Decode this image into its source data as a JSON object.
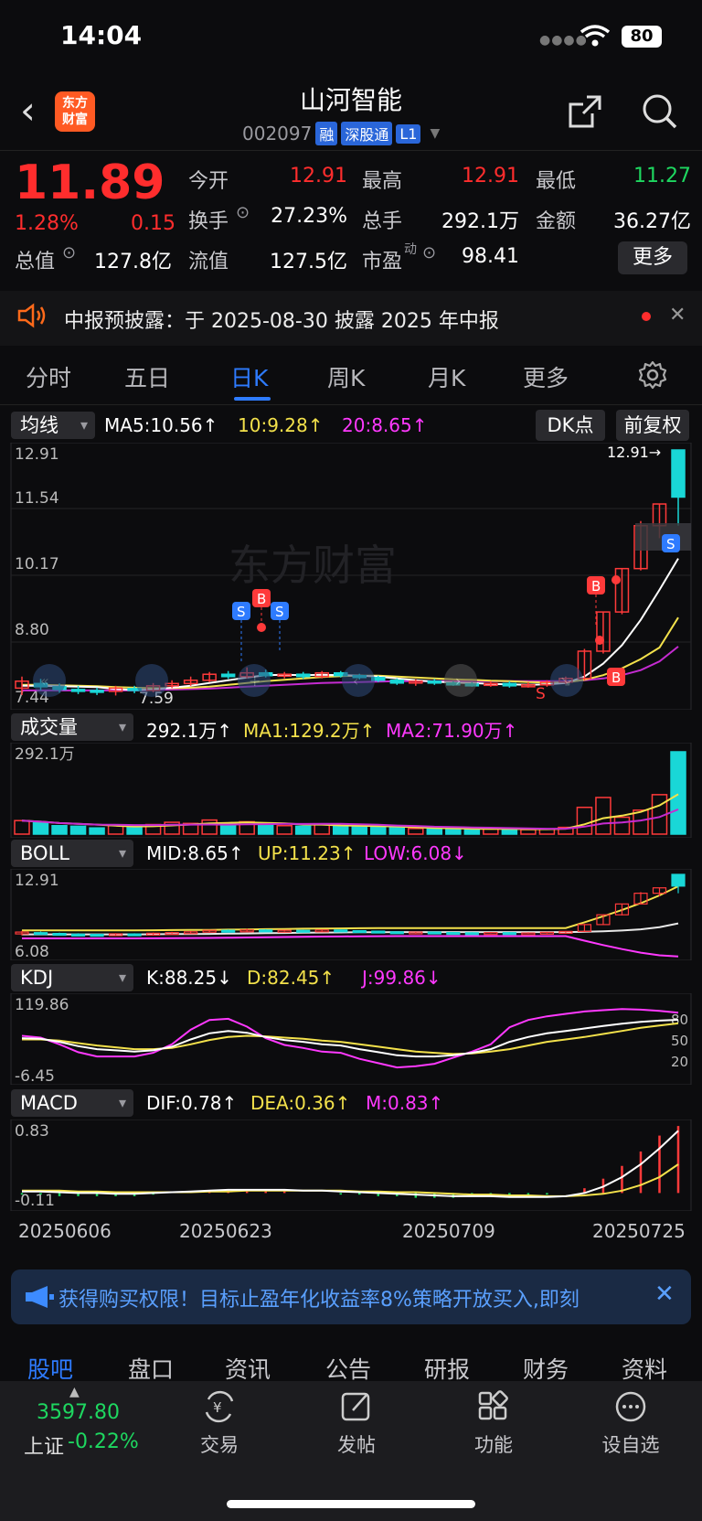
{
  "status_bar": {
    "time": "14:04",
    "battery": "80"
  },
  "header": {
    "logo_text": "东方\n财富",
    "stock_name": "山河智能",
    "code": "002097",
    "tags": [
      "融",
      "深股通",
      "L1"
    ]
  },
  "quote": {
    "price": "11.89",
    "change_pct": "1.28%",
    "change": "0.15",
    "fields": [
      {
        "label": "今开",
        "value": "12.91",
        "color": "red"
      },
      {
        "label": "最高",
        "value": "12.91",
        "color": "red"
      },
      {
        "label": "最低",
        "value": "11.27",
        "color": "green"
      },
      {
        "label": "换手",
        "value": "27.23%",
        "color": "white"
      },
      {
        "label": "总手",
        "value": "292.1万",
        "color": "white"
      },
      {
        "label": "金额",
        "value": "36.27亿",
        "color": "white"
      },
      {
        "label": "总值",
        "value": "127.8亿",
        "color": "white"
      },
      {
        "label": "流值",
        "value": "127.5亿",
        "color": "white"
      },
      {
        "label": "市盈",
        "value": "98.41",
        "color": "white"
      }
    ],
    "pe_superscript": "动",
    "more_label": "更多"
  },
  "notice": {
    "text": "中报预披露：于 2025-08-30 披露 2025 年中报"
  },
  "tabs": [
    "分时",
    "五日",
    "日K",
    "周K",
    "月K",
    "更多"
  ],
  "active_tab": "日K",
  "kline": {
    "indicator": "均线",
    "ma5": "MA5:10.56↑",
    "ma10": "10:9.28↑",
    "ma20": "20:8.65↑",
    "dk_label": "DK点",
    "adjust_label": "前复权",
    "axis": [
      "12.91",
      "11.54",
      "10.17",
      "8.80",
      "7.44"
    ],
    "low_mark": "7.59",
    "high_mark": "12.91→",
    "watermark": "东方财富"
  },
  "volume": {
    "indicator": "成交量",
    "value": "292.1万↑",
    "ma1": "MA1:129.2万↑",
    "ma2": "MA2:71.90万↑",
    "axis_top": "292.1万"
  },
  "boll": {
    "indicator": "BOLL",
    "mid": "MID:8.65↑",
    "up": "UP:11.23↑",
    "low": "LOW:6.08↓",
    "axis": [
      "12.91",
      "6.08"
    ]
  },
  "kdj": {
    "indicator": "KDJ",
    "k": "K:88.25↓",
    "d": "D:82.45↑",
    "j": "J:99.86↓",
    "axis": [
      "119.86",
      "-6.45"
    ],
    "levels": [
      "80",
      "50",
      "20"
    ]
  },
  "macd": {
    "indicator": "MACD",
    "dif": "DIF:0.78↑",
    "dea": "DEA:0.36↑",
    "m": "M:0.83↑",
    "axis": [
      "0.83",
      "-0.11"
    ]
  },
  "dates": [
    "20250606",
    "20250623",
    "20250709",
    "20250725"
  ],
  "ad": {
    "text": "获得购买权限！目标止盈年化收益率8%策略开放买入,即刻"
  },
  "bottom_tabs": [
    "股吧",
    "盘口",
    "资讯",
    "公告",
    "研报",
    "财务",
    "资料"
  ],
  "bottom_nav": {
    "index_value": "3597.80",
    "index_name": "上证",
    "index_change": "-0.22%",
    "items": [
      "交易",
      "发帖",
      "功能",
      "设自选"
    ]
  },
  "chart_data": {
    "type": "candlestick",
    "candles": [
      {
        "o": 7.75,
        "c": 7.9,
        "h": 8.0,
        "l": 7.6
      },
      {
        "o": 7.85,
        "c": 7.78,
        "h": 7.95,
        "l": 7.7
      },
      {
        "o": 7.78,
        "c": 7.72,
        "h": 7.85,
        "l": 7.65
      },
      {
        "o": 7.72,
        "c": 7.7,
        "h": 7.8,
        "l": 7.62
      },
      {
        "o": 7.7,
        "c": 7.68,
        "h": 7.76,
        "l": 7.6
      },
      {
        "o": 7.68,
        "c": 7.75,
        "h": 7.8,
        "l": 7.59
      },
      {
        "o": 7.74,
        "c": 7.7,
        "h": 7.8,
        "l": 7.64
      },
      {
        "o": 7.7,
        "c": 7.8,
        "h": 7.86,
        "l": 7.66
      },
      {
        "o": 7.8,
        "c": 7.85,
        "h": 7.92,
        "l": 7.75
      },
      {
        "o": 7.85,
        "c": 7.92,
        "h": 8.0,
        "l": 7.8
      },
      {
        "o": 7.92,
        "c": 8.05,
        "h": 8.1,
        "l": 7.88
      },
      {
        "o": 8.05,
        "c": 8.0,
        "h": 8.12,
        "l": 7.95
      },
      {
        "o": 8.0,
        "c": 8.08,
        "h": 8.2,
        "l": 7.96
      },
      {
        "o": 8.08,
        "c": 8.02,
        "h": 8.15,
        "l": 7.98
      },
      {
        "o": 8.02,
        "c": 8.05,
        "h": 8.1,
        "l": 7.96
      },
      {
        "o": 8.05,
        "c": 8.0,
        "h": 8.1,
        "l": 7.95
      },
      {
        "o": 8.0,
        "c": 8.08,
        "h": 8.12,
        "l": 7.96
      },
      {
        "o": 8.08,
        "c": 8.02,
        "h": 8.12,
        "l": 7.98
      },
      {
        "o": 8.02,
        "c": 7.98,
        "h": 8.06,
        "l": 7.94
      },
      {
        "o": 7.98,
        "c": 7.92,
        "h": 8.02,
        "l": 7.88
      },
      {
        "o": 7.92,
        "c": 7.86,
        "h": 7.96,
        "l": 7.82
      },
      {
        "o": 7.86,
        "c": 7.9,
        "h": 7.94,
        "l": 7.8
      },
      {
        "o": 7.9,
        "c": 7.86,
        "h": 7.95,
        "l": 7.82
      },
      {
        "o": 7.86,
        "c": 7.84,
        "h": 7.9,
        "l": 7.8
      },
      {
        "o": 7.84,
        "c": 7.82,
        "h": 7.88,
        "l": 7.78
      },
      {
        "o": 7.82,
        "c": 7.85,
        "h": 7.9,
        "l": 7.78
      },
      {
        "o": 7.85,
        "c": 7.8,
        "h": 7.9,
        "l": 7.76
      },
      {
        "o": 7.8,
        "c": 7.82,
        "h": 7.88,
        "l": 7.76
      },
      {
        "o": 7.82,
        "c": 7.88,
        "h": 7.92,
        "l": 7.78
      },
      {
        "o": 7.88,
        "c": 7.96,
        "h": 8.0,
        "l": 7.84
      },
      {
        "o": 7.96,
        "c": 8.55,
        "h": 8.6,
        "l": 7.92
      },
      {
        "o": 8.55,
        "c": 9.4,
        "h": 9.4,
        "l": 8.5
      },
      {
        "o": 9.4,
        "c": 10.34,
        "h": 10.34,
        "l": 9.35
      },
      {
        "o": 10.34,
        "c": 11.27,
        "h": 11.37,
        "l": 10.3
      },
      {
        "o": 11.27,
        "c": 11.74,
        "h": 11.74,
        "l": 11.0
      },
      {
        "o": 12.91,
        "c": 11.89,
        "h": 12.91,
        "l": 11.27
      }
    ],
    "ma5": [
      7.8,
      7.8,
      7.79,
      7.78,
      7.77,
      7.73,
      7.71,
      7.72,
      7.76,
      7.8,
      7.86,
      7.92,
      7.98,
      8.03,
      8.04,
      8.03,
      8.04,
      8.03,
      8.02,
      8.0,
      7.96,
      7.92,
      7.89,
      7.87,
      7.86,
      7.84,
      7.83,
      7.82,
      7.83,
      7.86,
      8.0,
      8.28,
      8.68,
      9.23,
      9.88,
      10.56
    ],
    "ma10": [
      7.82,
      7.82,
      7.81,
      7.8,
      7.79,
      7.77,
      7.76,
      7.75,
      7.75,
      7.76,
      7.78,
      7.82,
      7.86,
      7.9,
      7.93,
      7.96,
      7.99,
      8.01,
      8.02,
      8.02,
      8.0,
      7.98,
      7.96,
      7.94,
      7.93,
      7.91,
      7.9,
      7.88,
      7.87,
      7.87,
      7.93,
      8.03,
      8.18,
      8.38,
      8.63,
      9.28
    ],
    "ma20": [
      7.7,
      7.7,
      7.7,
      7.7,
      7.7,
      7.7,
      7.7,
      7.71,
      7.72,
      7.73,
      7.74,
      7.76,
      7.78,
      7.8,
      7.82,
      7.84,
      7.86,
      7.87,
      7.88,
      7.89,
      7.9,
      7.9,
      7.9,
      7.9,
      7.9,
      7.9,
      7.9,
      7.9,
      7.9,
      7.9,
      7.92,
      7.96,
      8.03,
      8.14,
      8.33,
      8.65
    ],
    "volume": [
      48,
      40,
      30,
      28,
      22,
      30,
      26,
      34,
      42,
      38,
      50,
      36,
      44,
      32,
      30,
      28,
      34,
      30,
      26,
      24,
      22,
      20,
      18,
      20,
      16,
      18,
      20,
      16,
      18,
      24,
      95,
      130,
      60,
      85,
      140,
      292.1
    ],
    "volume_up": [
      true,
      false,
      false,
      false,
      false,
      true,
      false,
      true,
      true,
      true,
      true,
      false,
      true,
      false,
      true,
      false,
      true,
      false,
      false,
      false,
      false,
      true,
      false,
      false,
      false,
      true,
      false,
      true,
      true,
      true,
      true,
      true,
      true,
      true,
      true,
      false
    ],
    "kdj_k": [
      58,
      57,
      52,
      45,
      40,
      38,
      36,
      38,
      44,
      56,
      66,
      70,
      67,
      60,
      55,
      52,
      48,
      46,
      40,
      35,
      30,
      28,
      28,
      30,
      34,
      40,
      52,
      60,
      66,
      70,
      74,
      78,
      82,
      85,
      87,
      88.25
    ],
    "kdj_d": [
      56,
      56,
      54,
      50,
      46,
      43,
      40,
      40,
      42,
      48,
      55,
      60,
      62,
      61,
      59,
      57,
      54,
      52,
      48,
      44,
      40,
      36,
      34,
      32,
      33,
      36,
      40,
      46,
      52,
      56,
      60,
      65,
      70,
      75,
      79,
      82.45
    ],
    "kdj_j": [
      62,
      59,
      48,
      35,
      28,
      28,
      28,
      34,
      48,
      72,
      88,
      90,
      77,
      58,
      47,
      42,
      36,
      34,
      24,
      17,
      10,
      12,
      16,
      26,
      36,
      48,
      76,
      88,
      94,
      98,
      102,
      104,
      106,
      105,
      103,
      99.86
    ],
    "macd_dif": [
      0.02,
      0.02,
      0.01,
      0.0,
      0.0,
      -0.01,
      -0.01,
      0.0,
      0.01,
      0.02,
      0.03,
      0.04,
      0.04,
      0.04,
      0.04,
      0.03,
      0.03,
      0.02,
      0.01,
      0.0,
      -0.01,
      -0.02,
      -0.03,
      -0.04,
      -0.04,
      -0.04,
      -0.05,
      -0.05,
      -0.05,
      -0.04,
      0.0,
      0.08,
      0.2,
      0.36,
      0.56,
      0.78
    ],
    "macd_dea": [
      0.03,
      0.03,
      0.03,
      0.02,
      0.02,
      0.01,
      0.01,
      0.01,
      0.01,
      0.01,
      0.02,
      0.02,
      0.03,
      0.03,
      0.03,
      0.03,
      0.03,
      0.03,
      0.02,
      0.02,
      0.01,
      0.01,
      0.0,
      -0.01,
      -0.02,
      -0.02,
      -0.03,
      -0.03,
      -0.04,
      -0.04,
      -0.03,
      -0.01,
      0.03,
      0.1,
      0.2,
      0.36
    ]
  }
}
